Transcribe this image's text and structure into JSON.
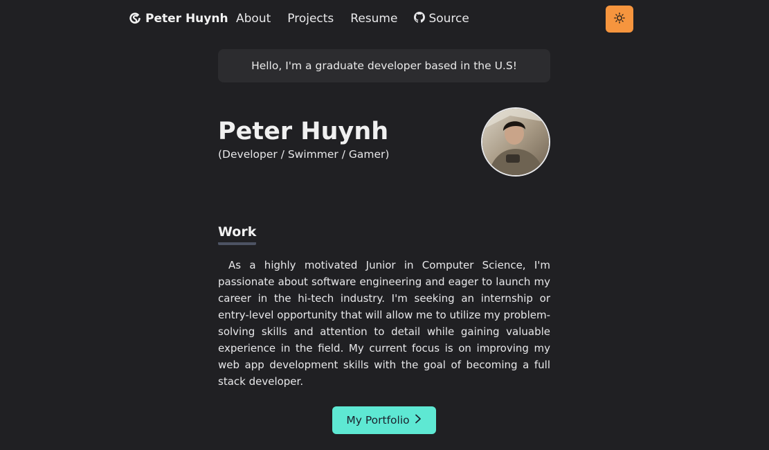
{
  "nav": {
    "brand": "Peter Huynh",
    "links": [
      {
        "label": "About"
      },
      {
        "label": "Projects"
      },
      {
        "label": "Resume"
      },
      {
        "label": "Source",
        "icon": "github-icon"
      }
    ],
    "theme_toggle_icon": "sun-icon"
  },
  "greeting": "Hello, I'm a graduate developer based in the U.S!",
  "profile": {
    "name": "Peter Huynh",
    "roles": "(Developer / Swimmer / Gamer)"
  },
  "work": {
    "title": "Work",
    "text": "As a highly motivated Junior in Computer Science, I'm passionate about software engineering and eager to launch my career in the hi-tech industry. I'm seeking an internship or entry-level opportunity that will allow me to utilize my problem-solving skills and attention to detail while gaining valuable experience in the field. My current focus is on improving my web app development skills with the goal of becoming a full stack developer."
  },
  "cta": {
    "label": "My Portfolio",
    "icon": "chevron-right-icon"
  },
  "colors": {
    "background": "#202023",
    "accent_button": "#5ee8d3",
    "theme_button": "#f6953e"
  }
}
